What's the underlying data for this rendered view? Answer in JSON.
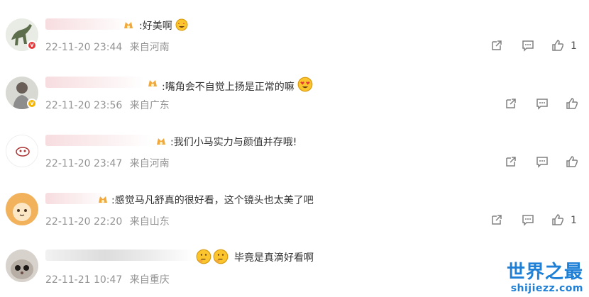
{
  "comments": [
    {
      "text": ":好美啊",
      "meta": {
        "date": "22-11-20 23:44",
        "location": "来自河南"
      },
      "likes": "1"
    },
    {
      "text": ":嘴角会不自觉上扬是正常的嘛",
      "meta": {
        "date": "22-11-20 23:56",
        "location": "来自广东"
      },
      "likes": ""
    },
    {
      "text": ":我们小马实力与颜值并存哦!",
      "meta": {
        "date": "22-11-20 23:47",
        "location": "来自河南"
      },
      "likes": ""
    },
    {
      "text": ":感觉马凡舒真的很好看，这个镜头也太美了吧",
      "meta": {
        "date": "22-11-20 22:20",
        "location": "来自山东"
      },
      "likes": "1"
    },
    {
      "text": "毕竟是真滴好看啊",
      "meta": {
        "date": "22-11-21 10:47",
        "location": "来自重庆"
      },
      "likes": ""
    }
  ],
  "watermark": {
    "title": "世界之最",
    "site": "shijiezz.com"
  },
  "colors": {
    "meta_gray": "#939393",
    "watermark_blue": "#1e7fd6"
  }
}
